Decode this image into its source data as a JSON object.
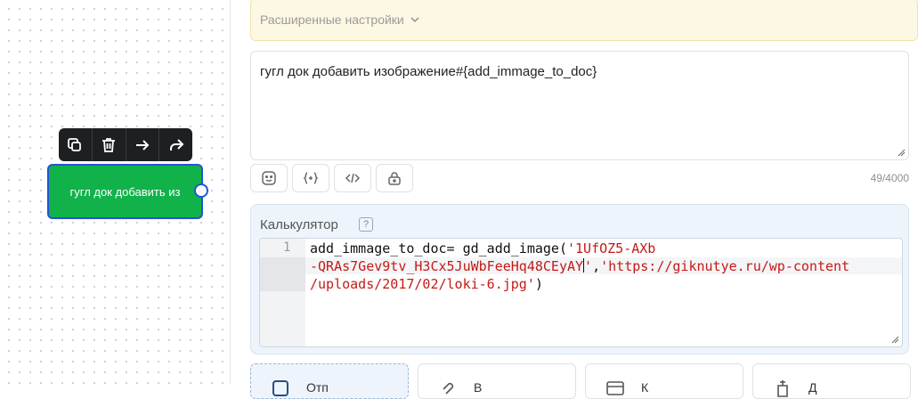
{
  "advanced": {
    "label": "Расширенные настройки"
  },
  "node": {
    "text": "гугл док добавить из"
  },
  "toolbar": {
    "buttons": [
      {
        "icon": "copy-icon"
      },
      {
        "icon": "trash-icon"
      },
      {
        "icon": "arrow-right-icon"
      },
      {
        "icon": "share-icon"
      }
    ]
  },
  "message": {
    "text": "гугл док добавить изображение#{add_immage_to_doc}",
    "counter": "49/4000"
  },
  "tools": [
    {
      "icon": "emoji-icon"
    },
    {
      "icon": "variable-braces-icon"
    },
    {
      "icon": "code-icon"
    },
    {
      "icon": "lock-icon"
    }
  ],
  "calculator": {
    "label": "Калькулятор",
    "help": "?",
    "line_number": "1",
    "code_plain_1": "add_immage_to_doc= gd_add_image(",
    "code_str_1": "'1UfOZ5-AXb",
    "code_str_2": "-QRAs7Gev9tv_H3Cx5JuWbFeeHq48CEyAY",
    "code_str_2b": "'",
    "code_plain_2": ",",
    "code_str_3": "'https://giknutye.ru/wp-content",
    "code_str_4": "/uploads/2017/02/loki-6.jpg'",
    "code_plain_3": ")"
  },
  "bottom_cards": [
    {
      "label": "Отп",
      "icon": "message-icon"
    },
    {
      "label": "В",
      "icon": "attachment-icon"
    },
    {
      "label": "К",
      "icon": "keyboard-icon"
    },
    {
      "label": "Д",
      "icon": "action-icon"
    }
  ],
  "colors": {
    "node": "#11b24a",
    "node_border": "#2453d8",
    "string": "#c41a16"
  }
}
